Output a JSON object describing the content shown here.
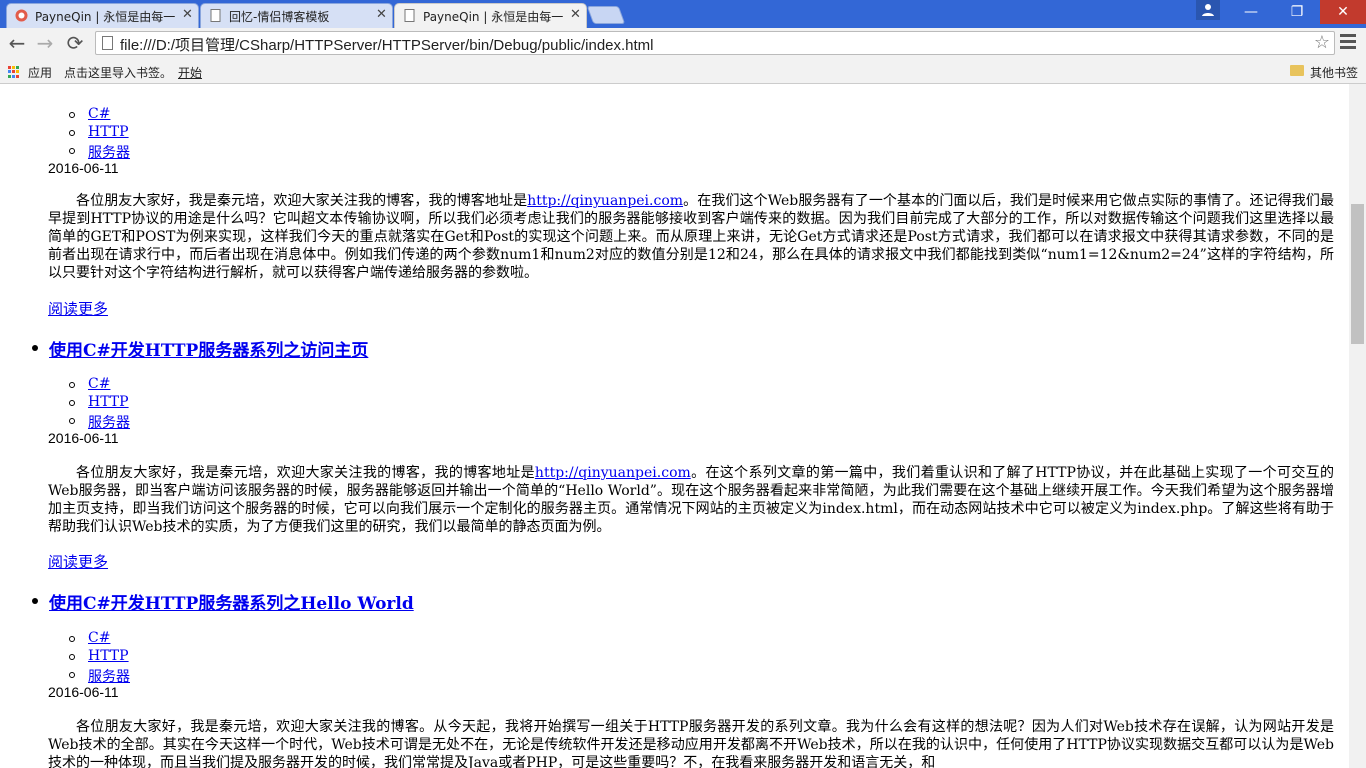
{
  "browser": {
    "tabs": [
      {
        "title": "PayneQin | 永恒是由每一",
        "active": false
      },
      {
        "title": "回忆-情侣博客模板",
        "active": false
      },
      {
        "title": "PayneQin | 永恒是由每一",
        "active": true
      }
    ],
    "url": "file:///D:/项目管理/CSharp/HTTPServer/HTTPServer/bin/Debug/public/index.html",
    "window_controls": {
      "minimize": "—",
      "maximize": "❐",
      "close": "✕"
    },
    "nav": {
      "back": "←",
      "forward": "→",
      "reload": "⟳"
    },
    "bookmarks": {
      "apps": "应用",
      "import": "点击这里导入书签。",
      "start": "开始",
      "other": "其他书签"
    }
  },
  "posts": [
    {
      "title": "",
      "tags": [
        "C#",
        "HTTP",
        "服务器"
      ],
      "date": "2016-06-11",
      "summary_pre": "各位朋友大家好，我是秦元培，欢迎大家关注我的博客，我的博客地址是",
      "link": "http://qinyuanpei.com",
      "summary_post": "。在我们这个Web服务器有了一个基本的门面以后，我们是时候来用它做点实际的事情了。还记得我们最早提到HTTP协议的用途是什么吗？它叫超文本传输协议啊，所以我们必须考虑让我们的服务器能够接收到客户端传来的数据。因为我们目前完成了大部分的工作，所以对数据传输这个问题我们这里选择以最简单的GET和POST为例来实现，这样我们今天的重点就落实在Get和Post的实现这个问题上来。而从原理上来讲，无论Get方式请求还是Post方式请求，我们都可以在请求报文中获得其请求参数，不同的是前者出现在请求行中，而后者出现在消息体中。例如我们传递的两个参数num1和num2对应的数值分别是12和24，那么在具体的请求报文中我们都能找到类似“num1=12&num2=24”这样的字符结构，所以只要针对这个字符结构进行解析，就可以获得客户端传递给服务器的参数啦。",
      "read_more": "阅读更多"
    },
    {
      "title": "使用C#开发HTTP服务器系列之访问主页",
      "tags": [
        "C#",
        "HTTP",
        "服务器"
      ],
      "date": "2016-06-11",
      "summary_pre": "各位朋友大家好，我是秦元培，欢迎大家关注我的博客，我的博客地址是",
      "link": "http://qinyuanpei.com",
      "summary_post": "。在这个系列文章的第一篇中，我们着重认识和了解了HTTP协议，并在此基础上实现了一个可交互的Web服务器，即当客户端访问该服务器的时候，服务器能够返回并输出一个简单的“Hello World”。现在这个服务器看起来非常简陋，为此我们需要在这个基础上继续开展工作。今天我们希望为这个服务器增加主页支持，即当我们访问这个服务器的时候，它可以向我们展示一个定制化的服务器主页。通常情况下网站的主页被定义为index.html，而在动态网站技术中它可以被定义为index.php。了解这些将有助于帮助我们认识Web技术的实质，为了方便我们这里的研究，我们以最简单的静态页面为例。",
      "read_more": "阅读更多"
    },
    {
      "title": "使用C#开发HTTP服务器系列之Hello World",
      "tags": [
        "C#",
        "HTTP",
        "服务器"
      ],
      "date": "2016-06-11",
      "summary_pre": "",
      "link": "",
      "summary_post": "各位朋友大家好，我是秦元培，欢迎大家关注我的博客。从今天起，我将开始撰写一组关于HTTP服务器开发的系列文章。我为什么会有这样的想法呢？因为人们对Web技术存在误解，认为网站开发是Web技术的全部。其实在今天这样一个时代，Web技术可谓是无处不在，无论是传统软件开发还是移动应用开发都离不开Web技术，所以在我的认识中，任何使用了HTTP协议实现数据交互都可以认为是Web技术的一种体现，而且当我们提及服务器开发的时候，我们常常提及Java或者PHP，可是这些重要吗？不，在我看来服务器开发和语言无关，和",
      "read_more": ""
    }
  ]
}
